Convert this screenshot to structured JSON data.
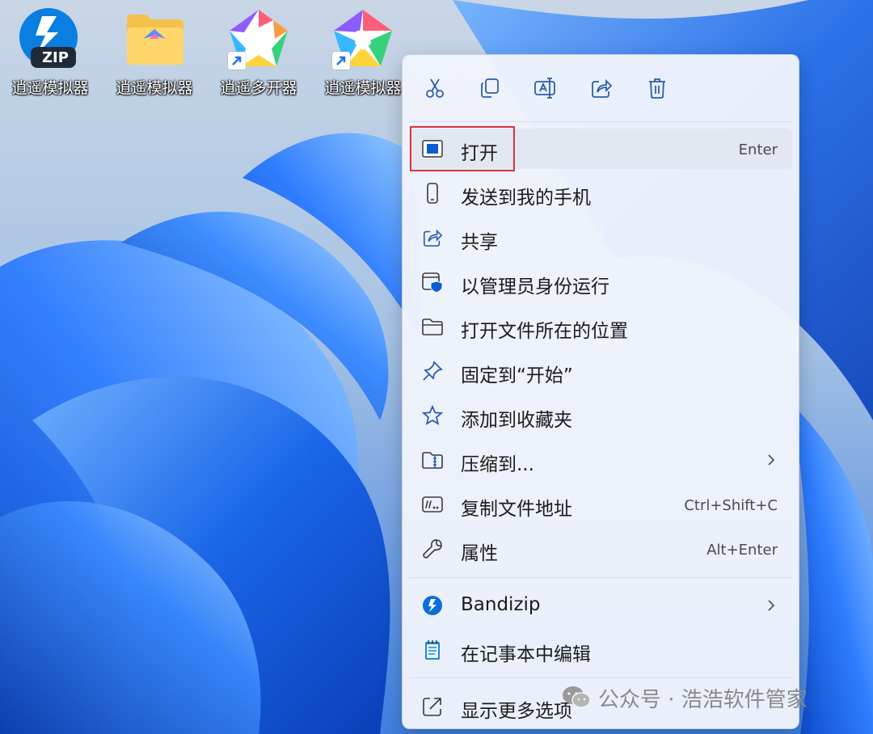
{
  "desktop": {
    "icons": [
      {
        "label": "逍遥模拟器",
        "badge": "ZIP"
      },
      {
        "label": "逍遥模拟器"
      },
      {
        "label": "逍遥多开器"
      },
      {
        "label": "逍遥模拟器"
      }
    ]
  },
  "context_menu": {
    "quick_actions": [
      "cut-icon",
      "copy-icon",
      "rename-icon",
      "share-icon",
      "delete-icon"
    ],
    "items": [
      {
        "label": "打开",
        "shortcut": "Enter",
        "icon": "open-window-icon"
      },
      {
        "label": "发送到我的手机",
        "icon": "phone-icon"
      },
      {
        "label": "共享",
        "icon": "share-icon"
      },
      {
        "label": "以管理员身份运行",
        "icon": "admin-shield-icon"
      },
      {
        "label": "打开文件所在的位置",
        "icon": "folder-icon"
      },
      {
        "label": "固定到“开始”",
        "icon": "pin-icon"
      },
      {
        "label": "添加到收藏夹",
        "icon": "star-icon"
      },
      {
        "label": "压缩到...",
        "icon": "zip-folder-icon"
      },
      {
        "label": "复制文件地址",
        "shortcut": "Ctrl+Shift+C",
        "icon": "path-icon"
      },
      {
        "label": "属性",
        "shortcut": "Alt+Enter",
        "icon": "wrench-icon"
      },
      {
        "label": "Bandizip",
        "icon": "bandizip-icon"
      },
      {
        "label": "在记事本中编辑",
        "icon": "notepad-icon"
      },
      {
        "label": "显示更多选项",
        "icon": "more-options-icon"
      }
    ]
  },
  "watermark": {
    "text": "公众号 · 浩浩软件管家"
  },
  "colors": {
    "highlight_border": "#e0303a",
    "accent": "#0067c0"
  }
}
